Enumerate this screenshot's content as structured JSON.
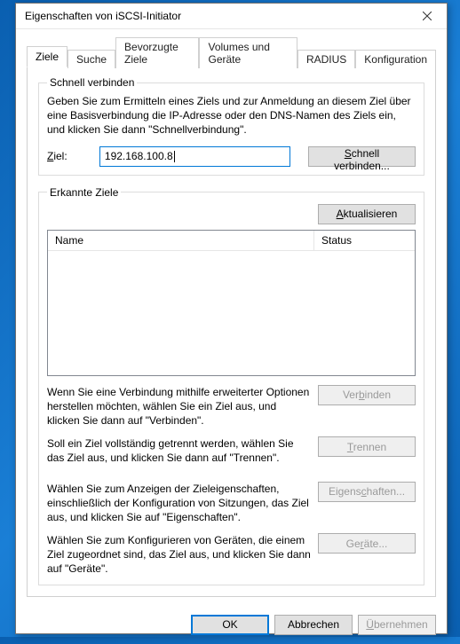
{
  "window": {
    "title": "Eigenschaften von iSCSI-Initiator"
  },
  "tabs": {
    "items": [
      "Ziele",
      "Suche",
      "Bevorzugte Ziele",
      "Volumes und Geräte",
      "RADIUS",
      "Konfiguration"
    ],
    "active_index": 0
  },
  "schnell": {
    "legend": "Schnell verbinden",
    "help": "Geben Sie zum Ermitteln eines Ziels und zur Anmeldung an diesem Ziel über eine Basisverbindung die IP-Adresse oder den DNS-Namen des Ziels ein, und klicken Sie dann \"Schnellverbindung\".",
    "ziel_label": "Ziel:",
    "ziel_value": "192.168.100.8",
    "button": "Schnell verbinden..."
  },
  "erkannte": {
    "legend": "Erkannte Ziele",
    "refresh": "Aktualisieren",
    "columns": {
      "name": "Name",
      "status": "Status"
    },
    "rows": []
  },
  "actions": {
    "verbinden": {
      "desc": "Wenn Sie eine Verbindung mithilfe erweiterter Optionen herstellen möchten, wählen Sie ein Ziel aus, und klicken Sie dann auf \"Verbinden\".",
      "label": "Verbinden"
    },
    "trennen": {
      "desc": "Soll ein Ziel vollständig getrennt werden, wählen Sie das Ziel aus, und klicken Sie dann auf \"Trennen\".",
      "label": "Trennen"
    },
    "eigenschaften": {
      "desc": "Wählen Sie zum Anzeigen der Zieleigenschaften, einschließlich der Konfiguration von Sitzungen, das Ziel aus, und klicken Sie auf \"Eigenschaften\".",
      "label": "Eigenschaften..."
    },
    "geraete": {
      "desc": "Wählen Sie zum Konfigurieren von Geräten, die einem Ziel zugeordnet sind, das Ziel aus, und klicken Sie dann auf \"Geräte\".",
      "label": "Geräte..."
    }
  },
  "dialog_buttons": {
    "ok": "OK",
    "cancel": "Abbrechen",
    "apply": "Übernehmen"
  }
}
